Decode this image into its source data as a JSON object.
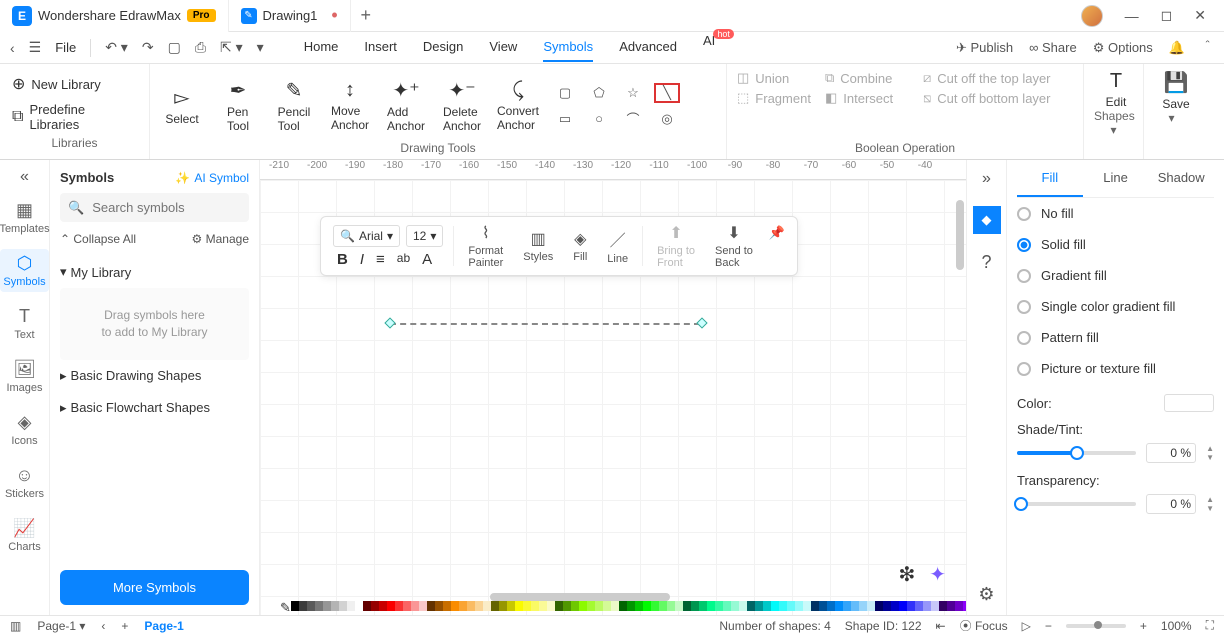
{
  "titlebar": {
    "app_name": "Wondershare EdrawMax",
    "pro": "Pro",
    "doc_name": "Drawing1",
    "add": "+"
  },
  "qat": {
    "file": "File",
    "menu": [
      "Home",
      "Insert",
      "Design",
      "View",
      "Symbols",
      "Advanced",
      "AI"
    ],
    "active": 4,
    "hot": "hot",
    "publish": "Publish",
    "share": "Share",
    "options": "Options"
  },
  "ribbon": {
    "libraries": {
      "new": "New Library",
      "predef": "Predefine Libraries",
      "label": "Libraries"
    },
    "drawing": {
      "select": "Select",
      "pen": "Pen\nTool",
      "pencil": "Pencil\nTool",
      "moveA": "Move\nAnchor",
      "addA": "Add\nAnchor",
      "delA": "Delete\nAnchor",
      "convA": "Convert\nAnchor",
      "label": "Drawing Tools"
    },
    "bool": {
      "union": "Union",
      "combine": "Combine",
      "cuttop": "Cut off the top layer",
      "fragment": "Fragment",
      "intersect": "Intersect",
      "cutbottom": "Cut off bottom layer",
      "label": "Boolean Operation"
    },
    "edit": {
      "edit": "Edit",
      "shapes": "Shapes"
    },
    "save": "Save"
  },
  "rail": {
    "items": [
      "Templates",
      "Symbols",
      "Text",
      "Images",
      "Icons",
      "Stickers",
      "Charts"
    ],
    "active": 1
  },
  "symbols": {
    "title": "Symbols",
    "ai": "AI Symbol",
    "search_ph": "Search symbols",
    "collapse": "Collapse All",
    "manage": "Manage",
    "mylib": "My Library",
    "drop1": "Drag symbols here",
    "drop2": "to add to My Library",
    "basic1": "Basic Drawing Shapes",
    "basic2": "Basic Flowchart Shapes",
    "more": "More Symbols"
  },
  "ruler": [
    "-210",
    "-200",
    "-190",
    "-180",
    "-170",
    "-160",
    "-150",
    "-140",
    "-130",
    "-120",
    "-110",
    "-100",
    "-90",
    "-80",
    "-70",
    "-60",
    "-50",
    "-40"
  ],
  "float": {
    "font": "Arial",
    "size": "12",
    "fmtpaint": "Format\nPainter",
    "styles": "Styles",
    "fill": "Fill",
    "line": "Line",
    "front": "Bring to\nFront",
    "back": "Send to\nBack"
  },
  "props": {
    "tabs": [
      "Fill",
      "Line",
      "Shadow"
    ],
    "active": 0,
    "nofill": "No fill",
    "solid": "Solid fill",
    "grad": "Gradient fill",
    "sgrad": "Single color gradient fill",
    "pattern": "Pattern fill",
    "picture": "Picture or texture fill",
    "color": "Color:",
    "shade": "Shade/Tint:",
    "shade_v": "0 %",
    "trans": "Transparency:",
    "trans_v": "0 %"
  },
  "status": {
    "page_sel": "Page-1",
    "page_tab": "Page-1",
    "shapes": "Number of shapes: 4",
    "shapeid": "Shape ID: 122",
    "focus": "Focus",
    "zoom": "100%"
  },
  "palette": [
    "#000000",
    "#3c3c3c",
    "#5a5a5a",
    "#787878",
    "#969696",
    "#b4b4b4",
    "#d2d2d2",
    "#f0f0f0",
    "#ffffff",
    "#640000",
    "#960000",
    "#c80000",
    "#fa0000",
    "#fa3232",
    "#fa6464",
    "#fa9696",
    "#fac8c8",
    "#643200",
    "#965000",
    "#c86e00",
    "#fa8c00",
    "#faa432",
    "#fabc64",
    "#fad496",
    "#faecc8",
    "#646400",
    "#969600",
    "#c8c800",
    "#fafa00",
    "#fafa32",
    "#fafa64",
    "#fafa96",
    "#fafac8",
    "#326400",
    "#509600",
    "#6ec800",
    "#8cfa00",
    "#a4fa32",
    "#bcfa64",
    "#d4fa96",
    "#ecfac8",
    "#006400",
    "#009600",
    "#00c800",
    "#00fa00",
    "#32fa32",
    "#64fa64",
    "#96fa96",
    "#c8fac8",
    "#006432",
    "#009650",
    "#00c86e",
    "#00fa8c",
    "#32faa4",
    "#64fabc",
    "#96fad4",
    "#c8faec",
    "#006464",
    "#009696",
    "#00c8c8",
    "#00fafa",
    "#32fafa",
    "#64fafa",
    "#96fafa",
    "#c8fafa",
    "#003264",
    "#005096",
    "#006ec8",
    "#008cfa",
    "#32a4fa",
    "#64bcfa",
    "#96d4fa",
    "#c8ecfa",
    "#000064",
    "#000096",
    "#0000c8",
    "#0000fa",
    "#3232fa",
    "#6464fa",
    "#9696fa",
    "#c8c8fa",
    "#320064",
    "#500096",
    "#6e00c8",
    "#8c00fa",
    "#a432fa",
    "#bc64fa",
    "#d496fa",
    "#ecc8fa",
    "#640064",
    "#960096",
    "#c800c8",
    "#fa00fa",
    "#fa32fa",
    "#fa64fa",
    "#fa96fa",
    "#fac8fa",
    "#640032",
    "#960050",
    "#c8006e",
    "#fa008c",
    "#fa32a4",
    "#fa64bc",
    "#fa96d4",
    "#fac8ec"
  ]
}
